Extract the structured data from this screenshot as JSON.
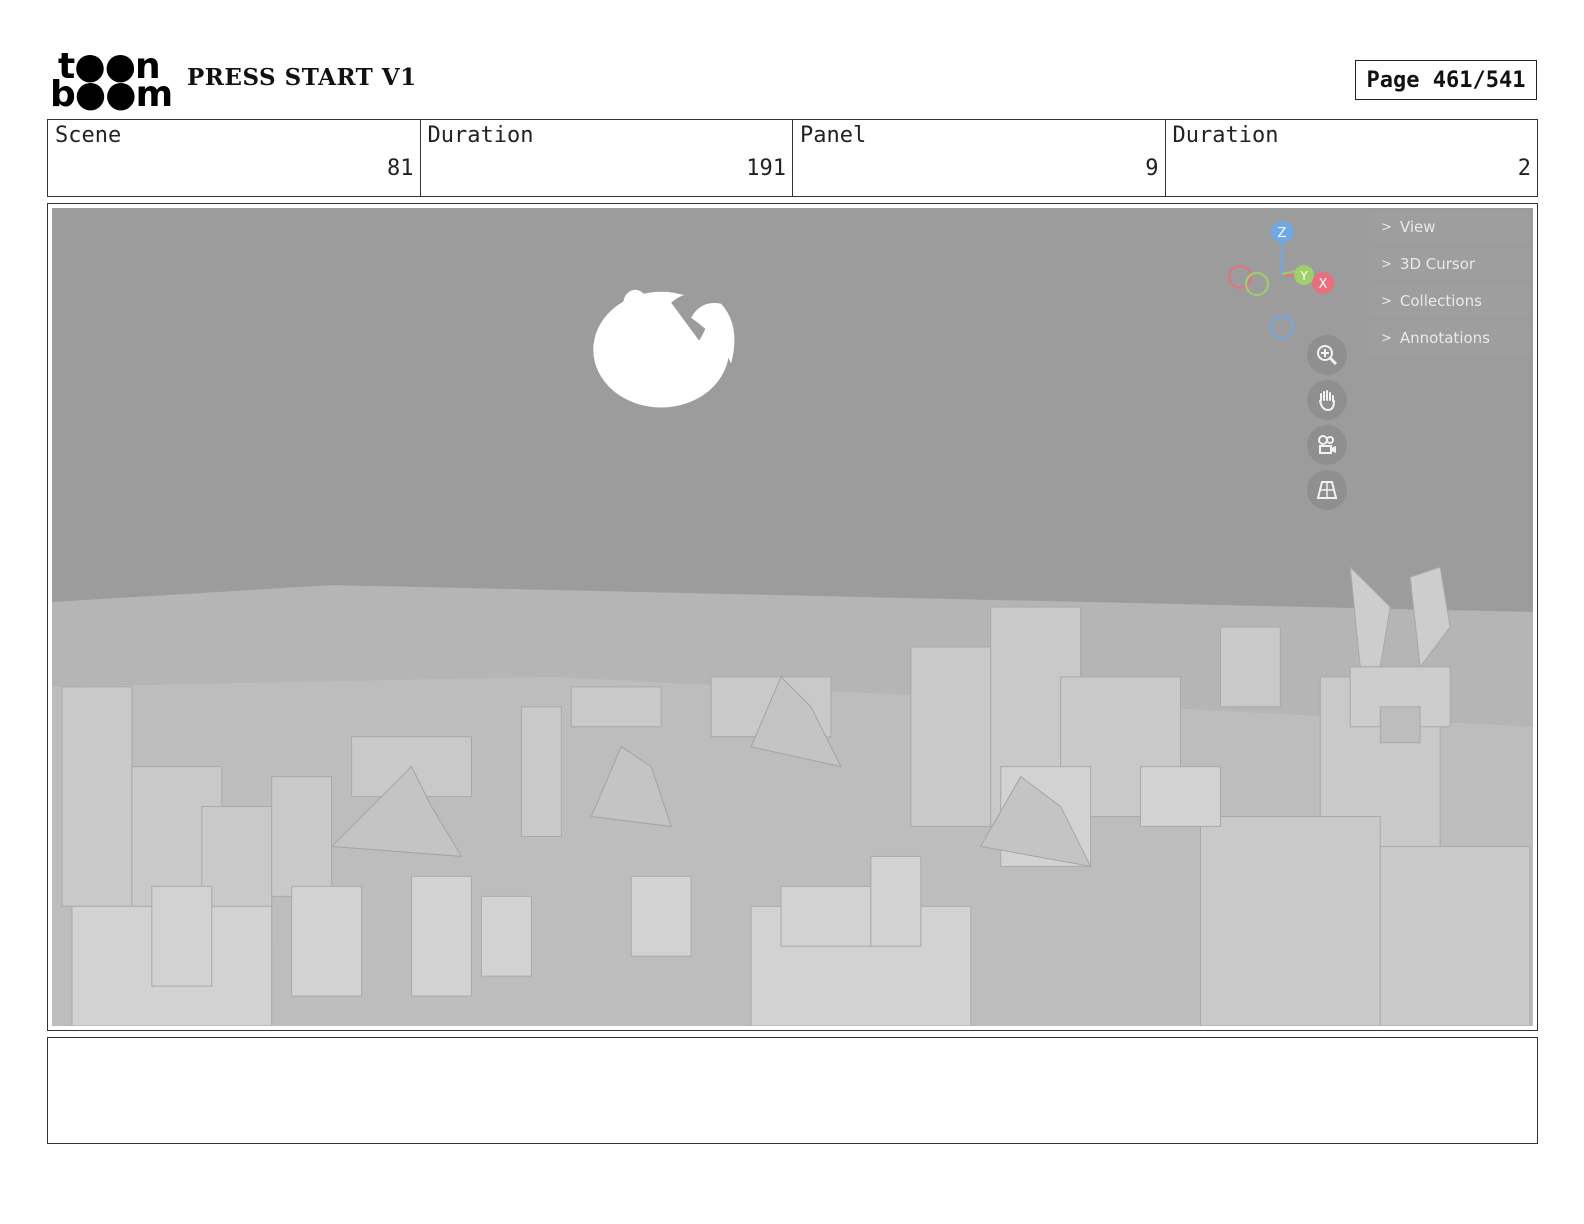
{
  "header": {
    "logo_top": "t●●n",
    "logo_bottom": "b●●m",
    "project_title": "PRESS START V1",
    "page_label": "Page 461/541"
  },
  "info": {
    "scene_label": "Scene",
    "scene_value": "81",
    "scene_duration_label": "Duration",
    "scene_duration_value": "191",
    "panel_label": "Panel",
    "panel_value": "9",
    "panel_duration_label": "Duration",
    "panel_duration_value": "2"
  },
  "viewport": {
    "sidebar_items": [
      "View",
      "3D Cursor",
      "Collections",
      "Annotations"
    ],
    "gizmo_axes": {
      "z": "Z",
      "y": "Y",
      "x": "X"
    },
    "nav_icons": [
      "zoom-icon",
      "hand-pan-icon",
      "camera-icon",
      "grid-perspective-icon"
    ],
    "colors": {
      "x_axis": "#e8707e",
      "y_axis": "#9fcf6a",
      "z_axis": "#6ea8e8",
      "background": "#9e9e9e"
    }
  },
  "notes": {
    "text": ""
  }
}
